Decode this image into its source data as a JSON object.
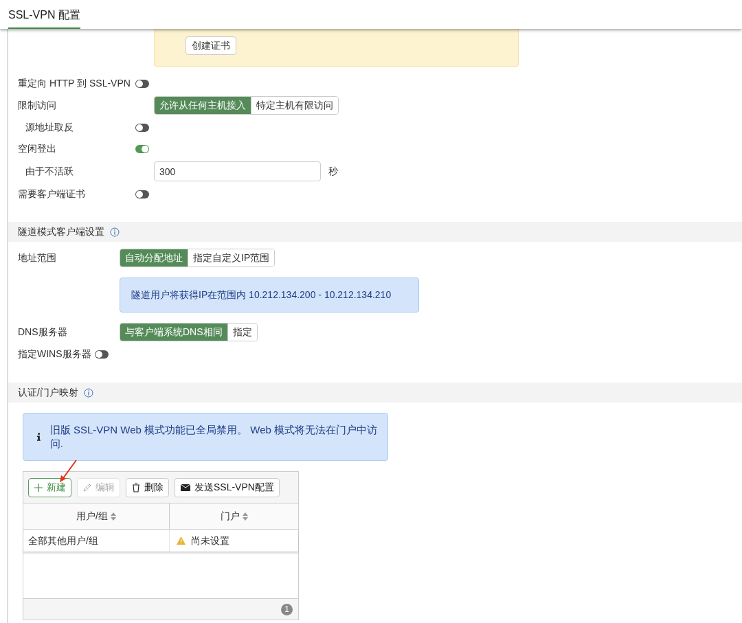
{
  "header": {
    "tab": {
      "label": "SSL-VPN 配置",
      "selected": true
    }
  },
  "certificate_notice": {
    "button": "创建证书"
  },
  "connection_settings": [
    {
      "kind": "toggle",
      "label": "重定向 HTTP 到 SSL-VPN",
      "on": false
    },
    {
      "kind": "segmented",
      "label": "限制访问",
      "options": [
        {
          "label": "允许从任何主机接入",
          "selected": true
        },
        {
          "label": "特定主机有限访问",
          "selected": false
        }
      ],
      "children": [
        {
          "kind": "toggle",
          "label": "源地址取反",
          "on": false
        }
      ]
    },
    {
      "kind": "toggle",
      "label": "空闲登出",
      "on": true,
      "children": [
        {
          "kind": "number",
          "label": "由于不活跃",
          "value": "300",
          "unit": "秒"
        }
      ]
    },
    {
      "kind": "toggle",
      "label": "需要客户端证书",
      "on": false
    }
  ],
  "tunnel_section": {
    "title": "隧道模式客户端设置",
    "rows": [
      {
        "kind": "segmented",
        "label": "地址范围",
        "options": [
          {
            "label": "自动分配地址",
            "selected": true
          },
          {
            "label": "指定自定义IP范围",
            "selected": false
          }
        ]
      },
      {
        "kind": "note",
        "text": "隧道用户将获得IP在范围内 10.212.134.200 - 10.212.134.210"
      },
      {
        "kind": "segmented",
        "label": "DNS服务器",
        "options": [
          {
            "label": "与客户端系统DNS相同",
            "selected": true
          },
          {
            "label": "指定",
            "selected": false
          }
        ]
      },
      {
        "kind": "inline_toggle",
        "label": "指定WINS服务器",
        "on": false
      }
    ]
  },
  "auth_section": {
    "title": "认证/门户映射",
    "notice": "旧版 SSL-VPN Web 模式功能已全局禁用。 Web 模式将无法在门户中访问.",
    "toolbar": [
      {
        "kind": "new",
        "label": "新建",
        "disabled": false
      },
      {
        "kind": "edit",
        "label": "编辑",
        "disabled": true
      },
      {
        "kind": "delete",
        "label": "删除",
        "disabled": false
      },
      {
        "kind": "send",
        "label": "发送SSL-VPN配置",
        "disabled": false
      }
    ],
    "table": {
      "columns": [
        "用户/组",
        "门户"
      ],
      "rows": [
        {
          "user_group": "全部其他用户/组",
          "portal": "尚未设置",
          "portal_warning": true
        }
      ],
      "count": "1"
    }
  }
}
